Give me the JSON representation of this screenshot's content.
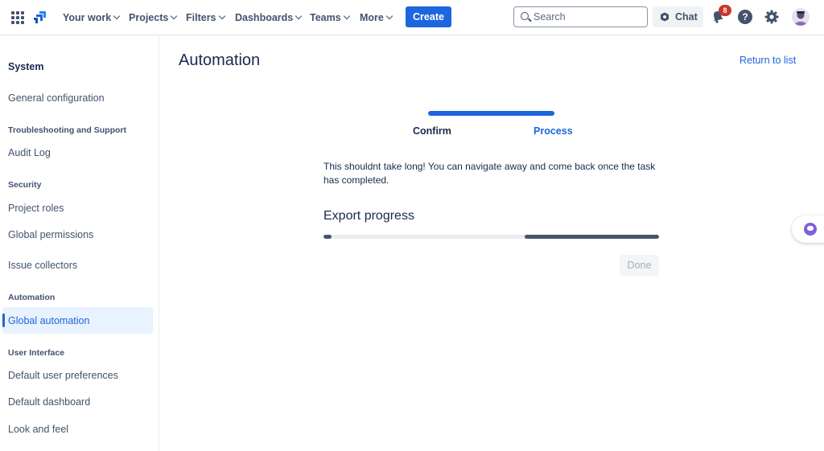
{
  "topnav": {
    "items": [
      {
        "label": "Your work"
      },
      {
        "label": "Projects"
      },
      {
        "label": "Filters"
      },
      {
        "label": "Dashboards"
      },
      {
        "label": "Teams"
      },
      {
        "label": "More"
      }
    ],
    "create_label": "Create",
    "search_placeholder": "Search",
    "chat_label": "Chat",
    "notification_count": "8",
    "help_label": "?"
  },
  "sidebar": {
    "title": "System",
    "sections": [
      {
        "heading": "",
        "items": [
          "General configuration"
        ]
      },
      {
        "heading": "Troubleshooting and Support",
        "items": [
          "Audit Log"
        ]
      },
      {
        "heading": "Security",
        "items": [
          "Project roles",
          "Global permissions",
          "Issue collectors"
        ]
      },
      {
        "heading": "Automation",
        "items": [
          "Global automation"
        ]
      },
      {
        "heading": "User Interface",
        "items": [
          "Default user preferences",
          "Default dashboard",
          "Look and feel"
        ]
      }
    ],
    "active_item": "Global automation"
  },
  "main": {
    "title": "Automation",
    "return_link": "Return to list",
    "steps": [
      {
        "label": "Confirm",
        "state": "done"
      },
      {
        "label": "Process",
        "state": "current"
      }
    ],
    "info_text": "This shouldnt take long! You can navigate away and come back once the task has completed.",
    "export_heading": "Export progress",
    "progress": {
      "start_fraction": 0.02,
      "active_from": 0.6,
      "active_to": 1.0
    },
    "done_label": "Done"
  },
  "colors": {
    "accent": "#1d66dd",
    "progress": "#44546f",
    "badge": "#c9372c"
  }
}
